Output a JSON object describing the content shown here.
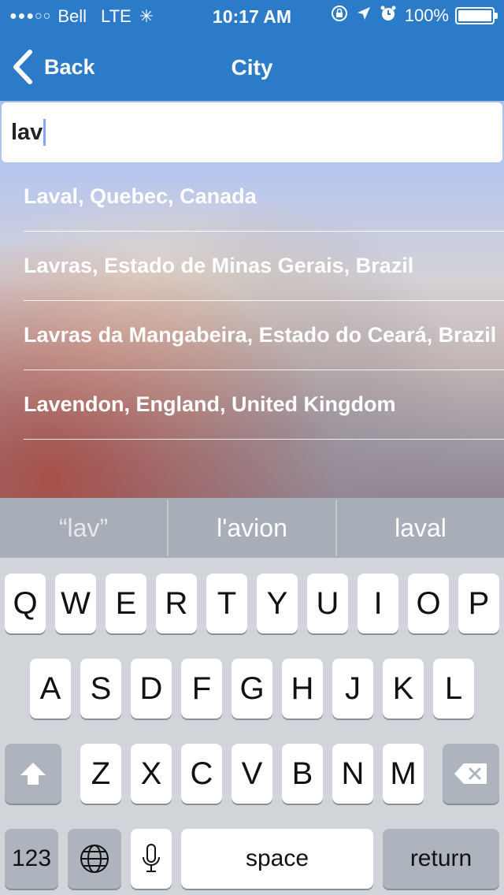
{
  "status_bar": {
    "signal_dots": "●●●○○",
    "carrier": "Bell",
    "network": "LTE",
    "time": "10:17 AM",
    "battery_percent": "100%",
    "battery_level": 1.0
  },
  "nav": {
    "back_label": "Back",
    "title": "City"
  },
  "search": {
    "value": "lav"
  },
  "results": [
    {
      "label": "Laval, Quebec, Canada"
    },
    {
      "label": "Lavras, Estado de Minas Gerais, Brazil"
    },
    {
      "label": "Lavras da Mangabeira, Estado do Ceará, Brazil"
    },
    {
      "label": "Lavendon, England, United Kingdom"
    }
  ],
  "keyboard": {
    "suggestions": [
      "“lav”",
      "l'avion",
      "laval"
    ],
    "row1": [
      "Q",
      "W",
      "E",
      "R",
      "T",
      "Y",
      "U",
      "I",
      "O",
      "P"
    ],
    "row2": [
      "A",
      "S",
      "D",
      "F",
      "G",
      "H",
      "J",
      "K",
      "L"
    ],
    "row3": [
      "Z",
      "X",
      "C",
      "V",
      "B",
      "N",
      "M"
    ],
    "numbers_label": "123",
    "space_label": "space",
    "return_label": "return"
  },
  "colors": {
    "header": "#2b7bc8",
    "keyboard_bg": "#d1d4d9",
    "suggestion_bar": "#a8aeb8"
  }
}
